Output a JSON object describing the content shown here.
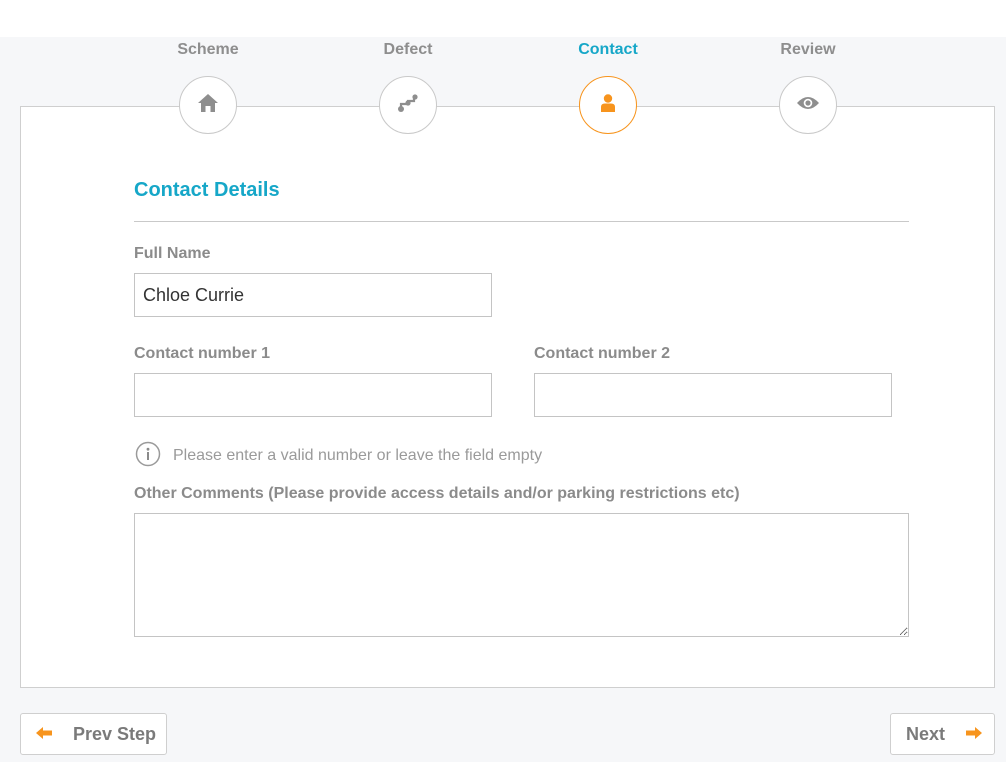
{
  "steps": [
    {
      "label": "Scheme",
      "icon": "home-icon",
      "active": false
    },
    {
      "label": "Defect",
      "icon": "defect-icon",
      "active": false
    },
    {
      "label": "Contact",
      "icon": "user-icon",
      "active": true
    },
    {
      "label": "Review",
      "icon": "eye-icon",
      "active": false
    }
  ],
  "form": {
    "section_title": "Contact Details",
    "full_name_label": "Full Name",
    "full_name_value": "Chloe Currie",
    "contact1_label": "Contact number 1",
    "contact1_value": "",
    "contact2_label": "Contact number 2",
    "contact2_value": "",
    "hint": "Please enter a valid number or leave the field empty",
    "comments_label": "Other Comments (Please provide access details and/or parking restrictions etc)",
    "comments_value": ""
  },
  "nav": {
    "prev_label": "Prev Step",
    "next_label": "Next"
  },
  "colors": {
    "accent": "#16a7c8",
    "active_step": "#f7941d",
    "arrow": "#f7941d",
    "muted": "#8e8e8e"
  }
}
